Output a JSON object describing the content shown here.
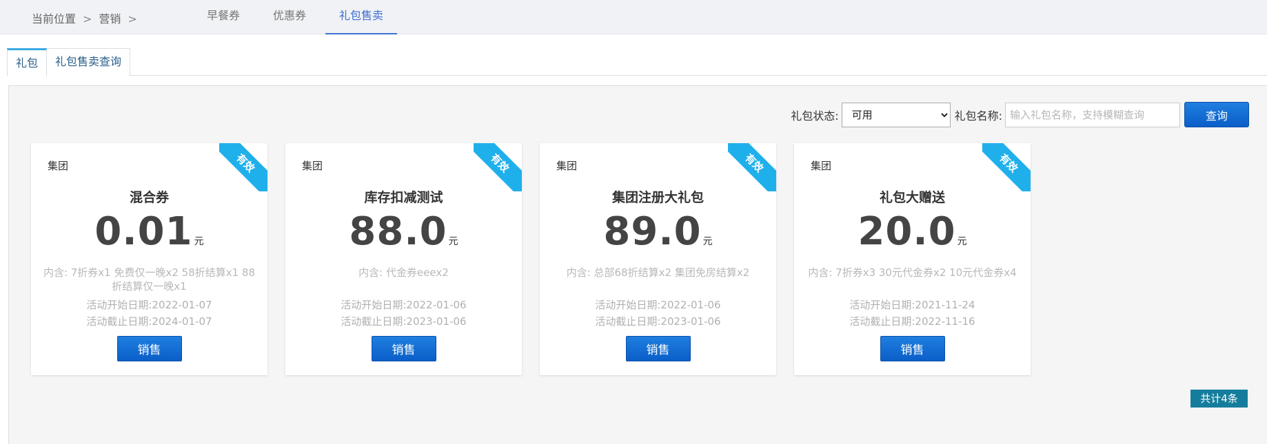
{
  "breadcrumb": {
    "label": "当前位置",
    "sep1": ">",
    "item": "营销",
    "sep2": ">"
  },
  "top_tabs": [
    {
      "label": "早餐券",
      "active": false
    },
    {
      "label": "优惠券",
      "active": false
    },
    {
      "label": "礼包售卖",
      "active": true
    }
  ],
  "sub_tabs": [
    {
      "label": "礼包",
      "active": true
    },
    {
      "label": "礼包售卖查询",
      "active": false
    }
  ],
  "filter": {
    "status_label": "礼包状态:",
    "status_value": "可用",
    "name_label": "礼包名称:",
    "name_placeholder": "输入礼包名称，支持模糊查询",
    "query_label": "查询"
  },
  "cards": [
    {
      "org": "集团",
      "title": "混合券",
      "price": "0.01",
      "unit": "元",
      "content": "内含: 7折券x1 免费仅一晚x2 58折结算x1 88折结算仅一晚x1",
      "start": "活动开始日期:2022-01-07",
      "end": "活动截止日期:2024-01-07",
      "badge": "有效",
      "button": "销售"
    },
    {
      "org": "集团",
      "title": "库存扣减测试",
      "price": "88.0",
      "unit": "元",
      "content": "内含: 代金券eeex2",
      "start": "活动开始日期:2022-01-06",
      "end": "活动截止日期:2023-01-06",
      "badge": "有效",
      "button": "销售"
    },
    {
      "org": "集团",
      "title": "集团注册大礼包",
      "price": "89.0",
      "unit": "元",
      "content": "内含: 总部68折结算x2 集团免房结算x2",
      "start": "活动开始日期:2022-01-06",
      "end": "活动截止日期:2023-01-06",
      "badge": "有效",
      "button": "销售"
    },
    {
      "org": "集团",
      "title": "礼包大赠送",
      "price": "20.0",
      "unit": "元",
      "content": "内含: 7折券x3 30元代金券x2 10元代金券x4",
      "start": "活动开始日期:2021-11-24",
      "end": "活动截止日期:2022-11-16",
      "badge": "有效",
      "button": "销售"
    }
  ],
  "total": "共计4条",
  "colors": {
    "accent": "#3f6fd1",
    "button": "#0a5ec8",
    "ribbon": "#1fb0ec",
    "total_badge": "#157d9c"
  }
}
